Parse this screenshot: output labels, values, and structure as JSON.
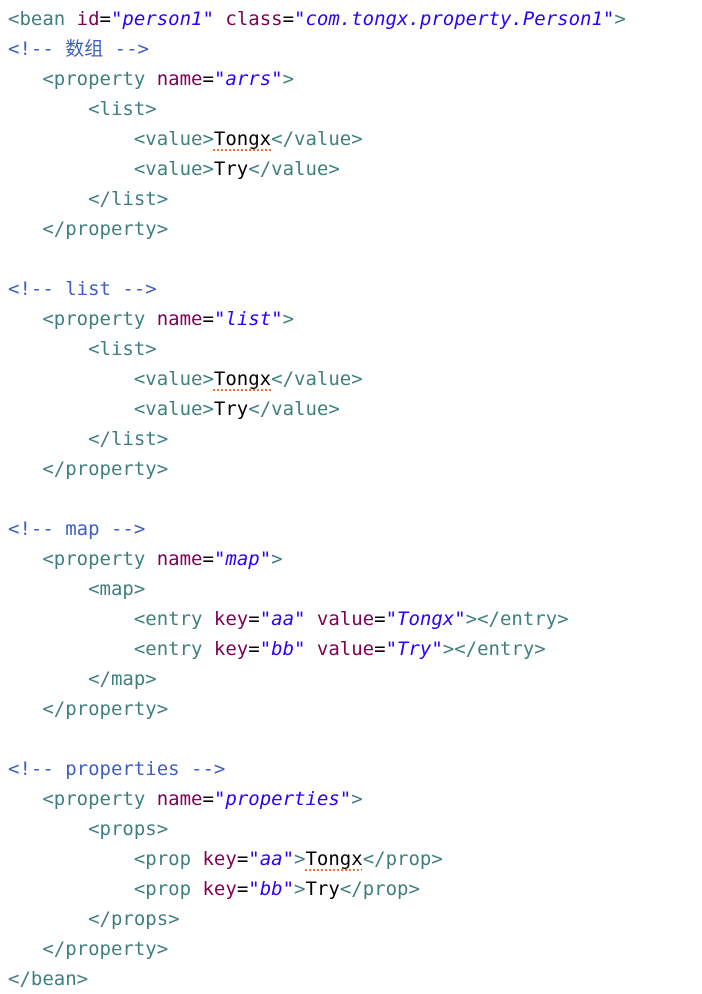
{
  "editor": {
    "colors": {
      "background": "#ffffff",
      "tag": "#3f7f7f",
      "attribute": "#7f0055",
      "string": "#2a00ff",
      "text": "#000000",
      "comment": "#3f5fbf",
      "spellcheck": "#e8762d"
    },
    "lines": [
      {
        "indent": "",
        "tokens": [
          {
            "t": "tag",
            "v": "<bean "
          },
          {
            "t": "attr",
            "v": "id"
          },
          {
            "t": "eq",
            "v": "="
          },
          {
            "t": "str",
            "v": "\"person1\""
          },
          {
            "t": "tag",
            "v": " "
          },
          {
            "t": "attr",
            "v": "class"
          },
          {
            "t": "eq",
            "v": "="
          },
          {
            "t": "str",
            "v": "\"com.tongx.property.Person1\""
          },
          {
            "t": "tag",
            "v": ">"
          }
        ]
      },
      {
        "indent": "",
        "tokens": [
          {
            "t": "com",
            "v": "<!-- 数组 -->"
          }
        ]
      },
      {
        "indent": "   ",
        "tokens": [
          {
            "t": "tag",
            "v": "<property "
          },
          {
            "t": "attr",
            "v": "name"
          },
          {
            "t": "eq",
            "v": "="
          },
          {
            "t": "str",
            "v": "\"arrs\""
          },
          {
            "t": "tag",
            "v": ">"
          }
        ]
      },
      {
        "indent": "       ",
        "tokens": [
          {
            "t": "tag",
            "v": "<list>"
          }
        ]
      },
      {
        "indent": "           ",
        "tokens": [
          {
            "t": "tag",
            "v": "<value>"
          },
          {
            "t": "txt",
            "v": "Tongx",
            "spell": true
          },
          {
            "t": "tag",
            "v": "</value>"
          }
        ]
      },
      {
        "indent": "           ",
        "tokens": [
          {
            "t": "tag",
            "v": "<value>"
          },
          {
            "t": "txt",
            "v": "Try"
          },
          {
            "t": "tag",
            "v": "</value>"
          }
        ]
      },
      {
        "indent": "       ",
        "tokens": [
          {
            "t": "tag",
            "v": "</list>"
          }
        ]
      },
      {
        "indent": "   ",
        "tokens": [
          {
            "t": "tag",
            "v": "</property>"
          }
        ]
      },
      {
        "indent": "",
        "tokens": []
      },
      {
        "indent": "",
        "tokens": [
          {
            "t": "com",
            "v": "<!-- list -->"
          }
        ]
      },
      {
        "indent": "   ",
        "tokens": [
          {
            "t": "tag",
            "v": "<property "
          },
          {
            "t": "attr",
            "v": "name"
          },
          {
            "t": "eq",
            "v": "="
          },
          {
            "t": "str",
            "v": "\"list\""
          },
          {
            "t": "tag",
            "v": ">"
          }
        ]
      },
      {
        "indent": "       ",
        "tokens": [
          {
            "t": "tag",
            "v": "<list>"
          }
        ]
      },
      {
        "indent": "           ",
        "tokens": [
          {
            "t": "tag",
            "v": "<value>"
          },
          {
            "t": "txt",
            "v": "Tongx",
            "spell": true
          },
          {
            "t": "tag",
            "v": "</value>"
          }
        ]
      },
      {
        "indent": "           ",
        "tokens": [
          {
            "t": "tag",
            "v": "<value>"
          },
          {
            "t": "txt",
            "v": "Try"
          },
          {
            "t": "tag",
            "v": "</value>"
          }
        ]
      },
      {
        "indent": "       ",
        "tokens": [
          {
            "t": "tag",
            "v": "</list>"
          }
        ]
      },
      {
        "indent": "   ",
        "tokens": [
          {
            "t": "tag",
            "v": "</property>"
          }
        ]
      },
      {
        "indent": "",
        "tokens": []
      },
      {
        "indent": "",
        "tokens": [
          {
            "t": "com",
            "v": "<!-- map -->"
          }
        ]
      },
      {
        "indent": "   ",
        "tokens": [
          {
            "t": "tag",
            "v": "<property "
          },
          {
            "t": "attr",
            "v": "name"
          },
          {
            "t": "eq",
            "v": "="
          },
          {
            "t": "str",
            "v": "\"map\""
          },
          {
            "t": "tag",
            "v": ">"
          }
        ]
      },
      {
        "indent": "       ",
        "tokens": [
          {
            "t": "tag",
            "v": "<map>"
          }
        ]
      },
      {
        "indent": "           ",
        "tokens": [
          {
            "t": "tag",
            "v": "<entry "
          },
          {
            "t": "attr",
            "v": "key"
          },
          {
            "t": "eq",
            "v": "="
          },
          {
            "t": "str",
            "v": "\"aa\""
          },
          {
            "t": "tag",
            "v": " "
          },
          {
            "t": "attr",
            "v": "value"
          },
          {
            "t": "eq",
            "v": "="
          },
          {
            "t": "str",
            "v": "\"Tongx\""
          },
          {
            "t": "tag",
            "v": "></entry>"
          }
        ]
      },
      {
        "indent": "           ",
        "tokens": [
          {
            "t": "tag",
            "v": "<entry "
          },
          {
            "t": "attr",
            "v": "key"
          },
          {
            "t": "eq",
            "v": "="
          },
          {
            "t": "str",
            "v": "\"bb\""
          },
          {
            "t": "tag",
            "v": " "
          },
          {
            "t": "attr",
            "v": "value"
          },
          {
            "t": "eq",
            "v": "="
          },
          {
            "t": "str",
            "v": "\"Try\""
          },
          {
            "t": "tag",
            "v": "></entry>"
          }
        ]
      },
      {
        "indent": "       ",
        "tokens": [
          {
            "t": "tag",
            "v": "</map>"
          }
        ]
      },
      {
        "indent": "   ",
        "tokens": [
          {
            "t": "tag",
            "v": "</property>"
          }
        ]
      },
      {
        "indent": "",
        "tokens": []
      },
      {
        "indent": "",
        "tokens": [
          {
            "t": "com",
            "v": "<!-- properties -->"
          }
        ]
      },
      {
        "indent": "   ",
        "tokens": [
          {
            "t": "tag",
            "v": "<property "
          },
          {
            "t": "attr",
            "v": "name"
          },
          {
            "t": "eq",
            "v": "="
          },
          {
            "t": "str",
            "v": "\"properties\""
          },
          {
            "t": "tag",
            "v": ">"
          }
        ]
      },
      {
        "indent": "       ",
        "tokens": [
          {
            "t": "tag",
            "v": "<props>"
          }
        ]
      },
      {
        "indent": "           ",
        "tokens": [
          {
            "t": "tag",
            "v": "<prop "
          },
          {
            "t": "attr",
            "v": "key"
          },
          {
            "t": "eq",
            "v": "="
          },
          {
            "t": "str",
            "v": "\"aa\""
          },
          {
            "t": "tag",
            "v": ">"
          },
          {
            "t": "txt",
            "v": "Tongx",
            "spell": true
          },
          {
            "t": "tag",
            "v": "</prop>"
          }
        ]
      },
      {
        "indent": "           ",
        "tokens": [
          {
            "t": "tag",
            "v": "<prop "
          },
          {
            "t": "attr",
            "v": "key"
          },
          {
            "t": "eq",
            "v": "="
          },
          {
            "t": "str",
            "v": "\"bb\""
          },
          {
            "t": "tag",
            "v": ">"
          },
          {
            "t": "txt",
            "v": "Try"
          },
          {
            "t": "tag",
            "v": "</prop>"
          }
        ]
      },
      {
        "indent": "       ",
        "tokens": [
          {
            "t": "tag",
            "v": "</props>"
          }
        ]
      },
      {
        "indent": "   ",
        "tokens": [
          {
            "t": "tag",
            "v": "</property>"
          }
        ]
      },
      {
        "indent": "",
        "tokens": [
          {
            "t": "tag",
            "v": "</bean>"
          }
        ]
      }
    ]
  }
}
